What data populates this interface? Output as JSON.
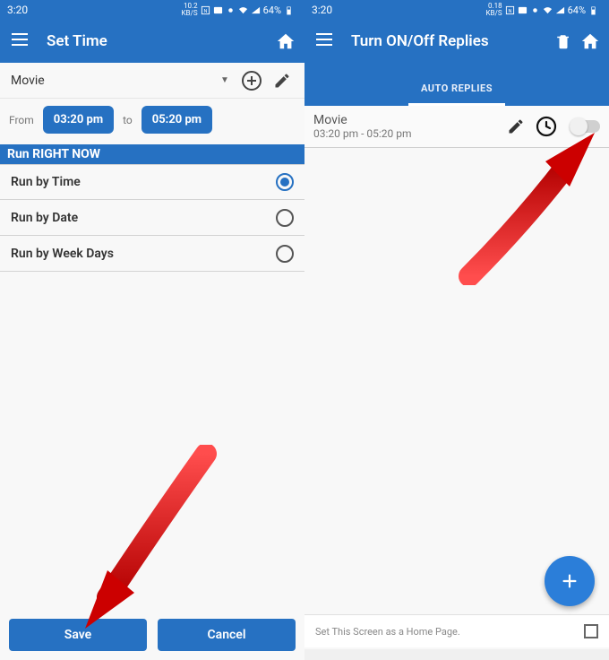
{
  "status": {
    "time": "3:20",
    "speed1": "10.2",
    "speed1u": "KB/S",
    "speed2": "0.18",
    "speed2u": "KB/S",
    "battery": "64%"
  },
  "left": {
    "appbar_title": "Set Time",
    "dropdown": {
      "label": "Movie"
    },
    "time": {
      "from_label": "From",
      "from_value": "03:20 pm",
      "to_label": "to",
      "to_value": "05:20 pm"
    },
    "banner": "Run RIGHT NOW",
    "options": [
      {
        "label": "Run by Time",
        "checked": true
      },
      {
        "label": "Run by Date",
        "checked": false
      },
      {
        "label": "Run by Week Days",
        "checked": false
      }
    ],
    "buttons": {
      "save": "Save",
      "cancel": "Cancel"
    }
  },
  "right": {
    "appbar_title": "Turn ON/Off Replies",
    "tab": "AUTO REPLIES",
    "item": {
      "title": "Movie",
      "time": "03:20 pm - 05:20 pm"
    },
    "footer": "Set This Screen as a Home Page."
  }
}
